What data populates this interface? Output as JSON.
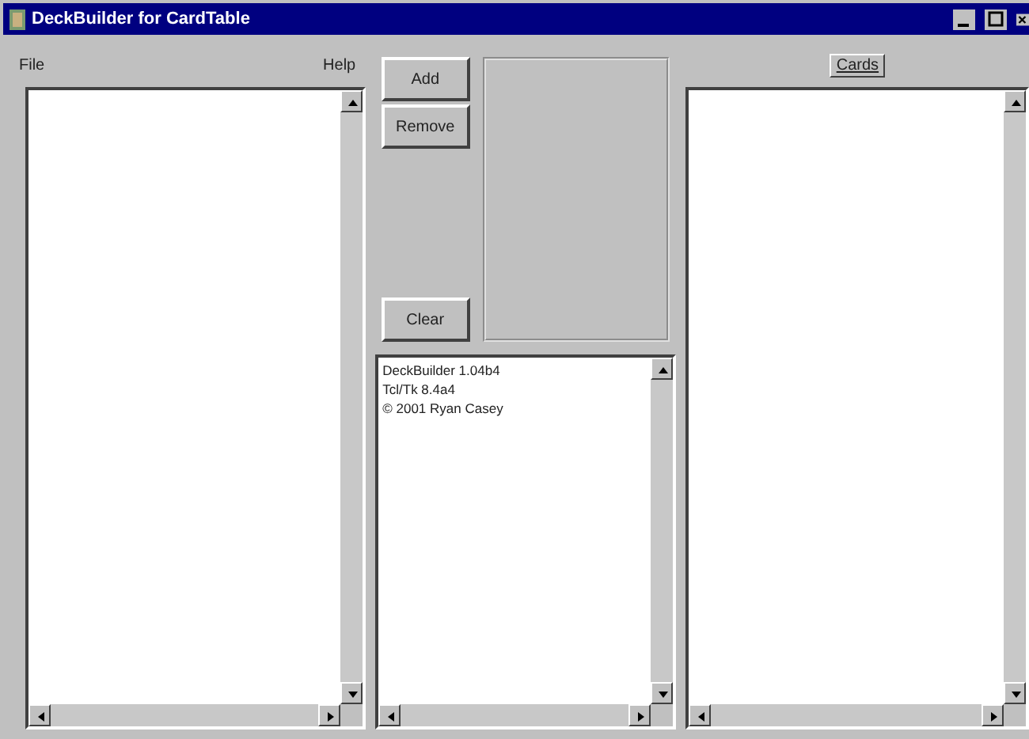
{
  "window": {
    "title": "DeckBuilder for CardTable"
  },
  "menu": [
    {
      "label": "File"
    },
    {
      "label": "Help"
    }
  ],
  "buttons": {
    "add": "Add",
    "remove": "Remove",
    "clear": "Clear",
    "cards": "Cards"
  },
  "info_lines": [
    "DeckBuilder 1.04b4",
    "Tcl/Tk 8.4a4",
    "© 2001 Ryan Casey"
  ]
}
